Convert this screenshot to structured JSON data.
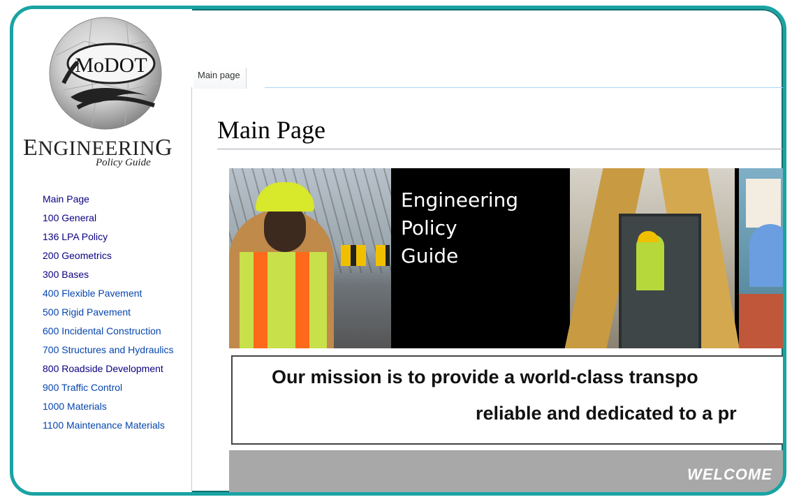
{
  "logo": {
    "text": "MoDOT",
    "title": "Engineering",
    "title_first": "E",
    "title_rest": "NGINEERIN",
    "title_last": "G",
    "subtitle": "Policy Guide"
  },
  "sidebar": {
    "items": [
      {
        "label": "Main Page"
      },
      {
        "label": "100 General"
      },
      {
        "label": "136 LPA Policy"
      },
      {
        "label": "200 Geometrics"
      },
      {
        "label": "300 Bases"
      },
      {
        "label": "400 Flexible Pavement"
      },
      {
        "label": "500 Rigid Pavement"
      },
      {
        "label": "600 Incidental Construction"
      },
      {
        "label": "700 Structures and Hydraulics"
      },
      {
        "label": "800 Roadside Development"
      },
      {
        "label": "900 Traffic Control"
      },
      {
        "label": "1000 Materials"
      },
      {
        "label": "1100 Maintenance Materials"
      }
    ]
  },
  "tabs": {
    "main": "Main page"
  },
  "page": {
    "title": "Main Page"
  },
  "banner": {
    "line1": "Engineering",
    "line2": "Policy",
    "line3": "Guide"
  },
  "mission": {
    "line1": "Our mission is to provide a world-class transpo",
    "line2": "reliable and dedicated to a pr"
  },
  "welcome": {
    "text": "WELCOME"
  },
  "colors": {
    "frame": "#1aa3a3",
    "link": "#0645ad",
    "link_visited": "#0b0080"
  }
}
